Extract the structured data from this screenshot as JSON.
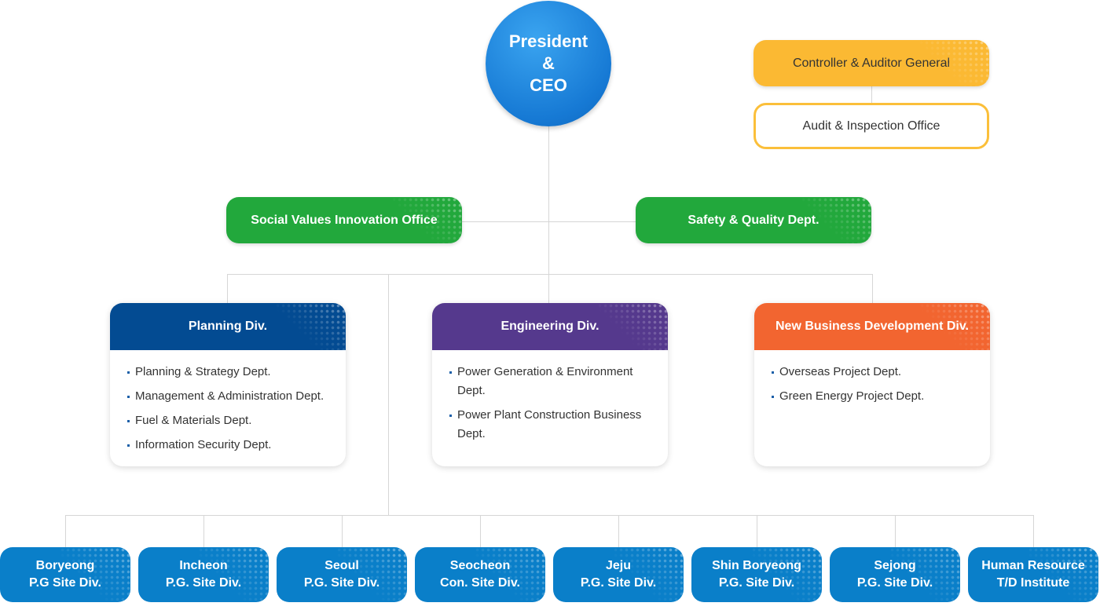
{
  "president": {
    "lines": [
      "President",
      "&",
      "CEO"
    ]
  },
  "controller": {
    "label": "Controller & Auditor General",
    "color": "#fbb933"
  },
  "audit": {
    "label": "Audit & Inspection Office"
  },
  "offices": [
    {
      "label": "Social Values Innovation Office"
    },
    {
      "label": "Safety & Quality Dept."
    }
  ],
  "divisions": [
    {
      "title": "Planning Div.",
      "color": "#034b92",
      "items": [
        "Planning & Strategy Dept.",
        "Management & Administration Dept.",
        "Fuel & Materials Dept.",
        "Information Security Dept."
      ]
    },
    {
      "title": "Engineering Div.",
      "color": "#55398d",
      "items": [
        "Power Generation & Environment Dept.",
        "Power Plant Construction Business Dept."
      ]
    },
    {
      "title": "New Business Development Div.",
      "color": "#f26530",
      "items": [
        "Overseas Project Dept.",
        "Green Energy Project Dept."
      ]
    }
  ],
  "sites": [
    {
      "l1": "Boryeong",
      "l2": "P.G Site Div."
    },
    {
      "l1": "Incheon",
      "l2": "P.G. Site Div."
    },
    {
      "l1": "Seoul",
      "l2": "P.G. Site Div."
    },
    {
      "l1": "Seocheon",
      "l2": "Con. Site Div."
    },
    {
      "l1": "Jeju",
      "l2": "P.G. Site Div."
    },
    {
      "l1": "Shin Boryeong",
      "l2": "P.G. Site Div."
    },
    {
      "l1": "Sejong",
      "l2": "P.G. Site Div."
    },
    {
      "l1": "Human Resource",
      "l2": "T/D Institute"
    }
  ]
}
